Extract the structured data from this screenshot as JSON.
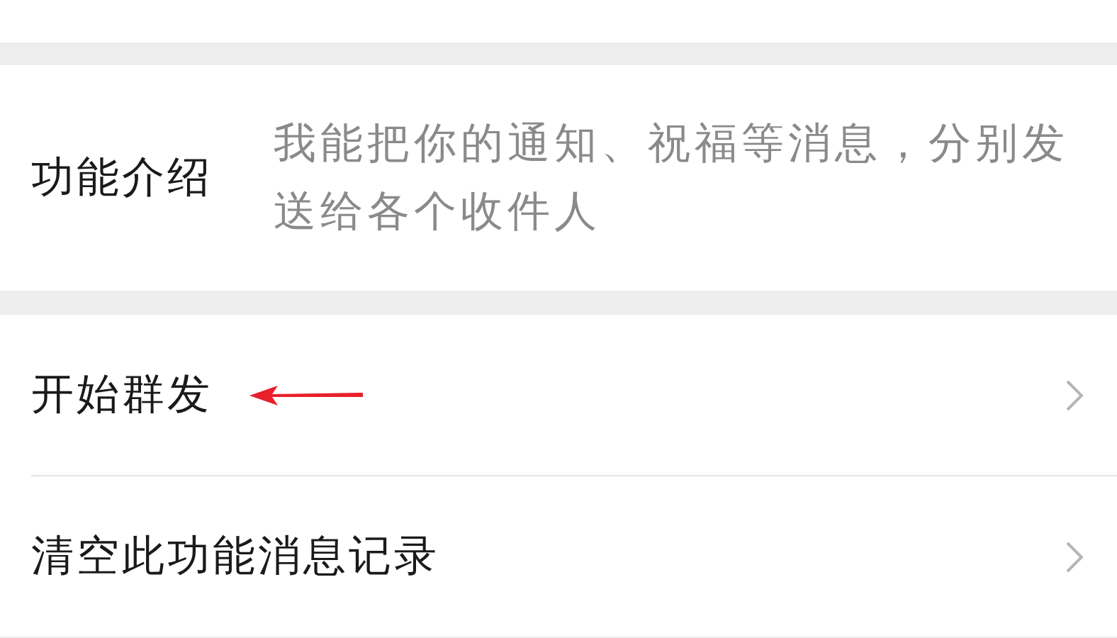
{
  "intro": {
    "label": "功能介绍",
    "description": "我能把你的通知、祝福等消息，分别发送给各个收件人"
  },
  "rows": [
    {
      "label": "开始群发",
      "annotated": true
    },
    {
      "label": "清空此功能消息记录",
      "annotated": false
    }
  ]
}
